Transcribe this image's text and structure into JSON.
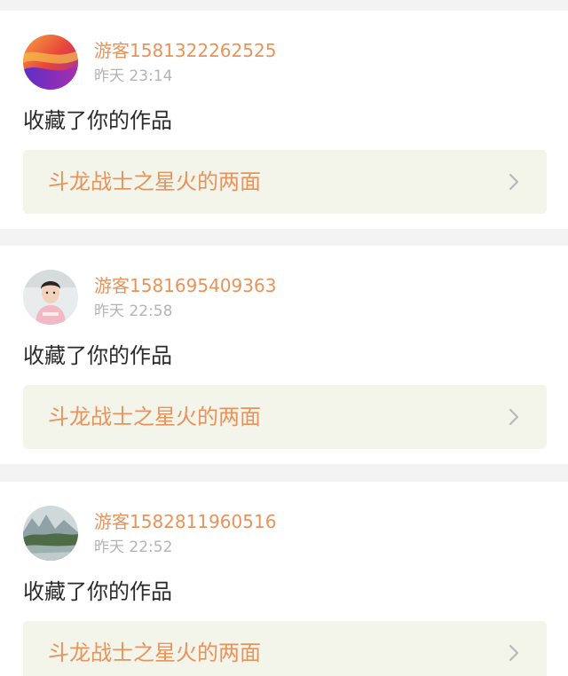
{
  "notifications": [
    {
      "username": "游客1581322262525",
      "timestamp": "昨天 23:14",
      "action": "收藏了你的作品",
      "work_title": "斗龙战士之星火的两面",
      "avatar_icon": "gradient-wave-avatar"
    },
    {
      "username": "游客1581695409363",
      "timestamp": "昨天 22:58",
      "action": "收藏了你的作品",
      "work_title": "斗龙战士之星火的两面",
      "avatar_icon": "person-photo-avatar"
    },
    {
      "username": "游客1582811960516",
      "timestamp": "昨天 22:52",
      "action": "收藏了你的作品",
      "work_title": "斗龙战士之星火的两面",
      "avatar_icon": "landscape-photo-avatar"
    }
  ],
  "colors": {
    "accent": "#e8935a",
    "timestamp": "#b4b4b4",
    "link_bg": "#f3f4ea",
    "page_bg": "#f3f3f3"
  }
}
